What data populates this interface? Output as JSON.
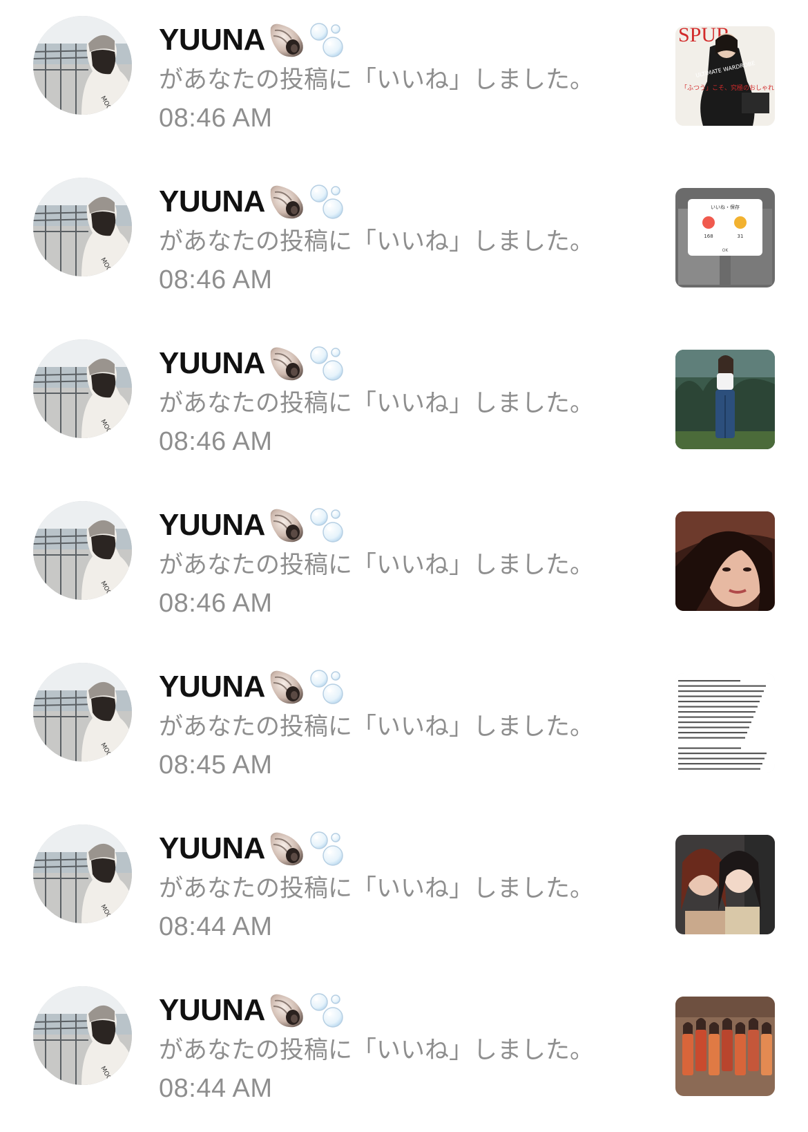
{
  "notifications": [
    {
      "username": "YUUNA",
      "emoji_icons": [
        "spiral-shell-icon",
        "bubbles-icon"
      ],
      "message": "があなたの投稿に「いいね」しました。",
      "time": "08:46 AM",
      "thumbnail": "magazine-cover-thumbnail",
      "thumbnail_text": {
        "masthead": "SPUR",
        "headline": "ULTIMATE WARDROBE",
        "sub": "「ふつう」こそ、究極のおしゃれ"
      }
    },
    {
      "username": "YUUNA",
      "emoji_icons": [
        "spiral-shell-icon",
        "bubbles-icon"
      ],
      "message": "があなたの投稿に「いいね」しました。",
      "time": "08:46 AM",
      "thumbnail": "likes-popup-screenshot-thumbnail",
      "thumbnail_text": {
        "header": "いいね・保存",
        "likes": "168",
        "saves": "31",
        "ok": "OK"
      }
    },
    {
      "username": "YUUNA",
      "emoji_icons": [
        "spiral-shell-icon",
        "bubbles-icon"
      ],
      "message": "があなたの投稿に「いいね」しました。",
      "time": "08:46 AM",
      "thumbnail": "person-in-garden-photo-thumbnail"
    },
    {
      "username": "YUUNA",
      "emoji_icons": [
        "spiral-shell-icon",
        "bubbles-icon"
      ],
      "message": "があなたの投稿に「いいね」しました。",
      "time": "08:46 AM",
      "thumbnail": "portrait-closeup-photo-thumbnail"
    },
    {
      "username": "YUUNA",
      "emoji_icons": [
        "spiral-shell-icon",
        "bubbles-icon"
      ],
      "message": "があなたの投稿に「いいね」しました。",
      "time": "08:45 AM",
      "thumbnail": "text-document-thumbnail"
    },
    {
      "username": "YUUNA",
      "emoji_icons": [
        "spiral-shell-icon",
        "bubbles-icon"
      ],
      "message": "があなたの投稿に「いいね」しました。",
      "time": "08:44 AM",
      "thumbnail": "two-person-selfie-photo-thumbnail"
    },
    {
      "username": "YUUNA",
      "emoji_icons": [
        "spiral-shell-icon",
        "bubbles-icon"
      ],
      "message": "があなたの投稿に「いいね」しました。",
      "time": "08:44 AM",
      "thumbnail": "group-photo-thumbnail"
    }
  ],
  "colors": {
    "background": "#ffffff",
    "username": "#111111",
    "secondary_text": "#8e8e8e"
  }
}
